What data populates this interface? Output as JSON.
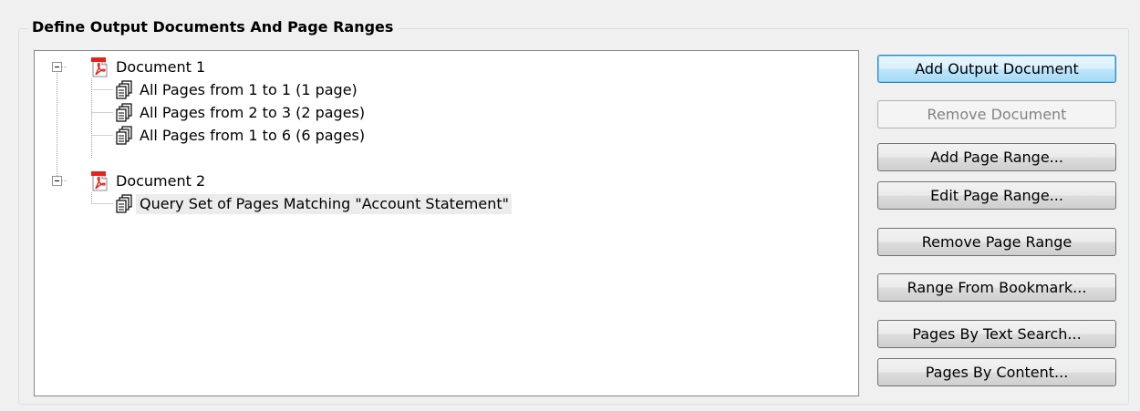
{
  "group": {
    "title": "Define Output Documents And Page Ranges"
  },
  "tree": {
    "documents": [
      {
        "label": "Document 1",
        "icon": "pdf-document-icon",
        "expanded": true,
        "ranges": [
          {
            "label": "All Pages from 1 to 1 (1 page)",
            "icon": "pages-icon"
          },
          {
            "label": "All Pages from 2 to 3 (2 pages)",
            "icon": "pages-icon"
          },
          {
            "label": "All Pages from 1 to 6 (6 pages)",
            "icon": "pages-icon"
          }
        ]
      },
      {
        "label": "Document 2",
        "icon": "pdf-document-icon",
        "expanded": true,
        "ranges": [
          {
            "label": "Query Set of Pages Matching \"Account Statement\"",
            "icon": "pages-icon",
            "selected": true
          }
        ]
      }
    ]
  },
  "buttons": {
    "add_output_document": "Add Output Document",
    "remove_document": "Remove Document",
    "add_page_range": "Add Page Range...",
    "edit_page_range": "Edit Page Range...",
    "remove_page_range": "Remove Page Range",
    "range_from_bookmark": "Range From Bookmark...",
    "pages_by_text_search": "Pages By Text Search...",
    "pages_by_content": "Pages By Content..."
  },
  "colors": {
    "window_background": "#f0f0f0",
    "pdf_red": "#e2231a",
    "default_button_border": "#3c7fb1",
    "disabled_text": "#838383",
    "selection_background": "#ececec"
  }
}
